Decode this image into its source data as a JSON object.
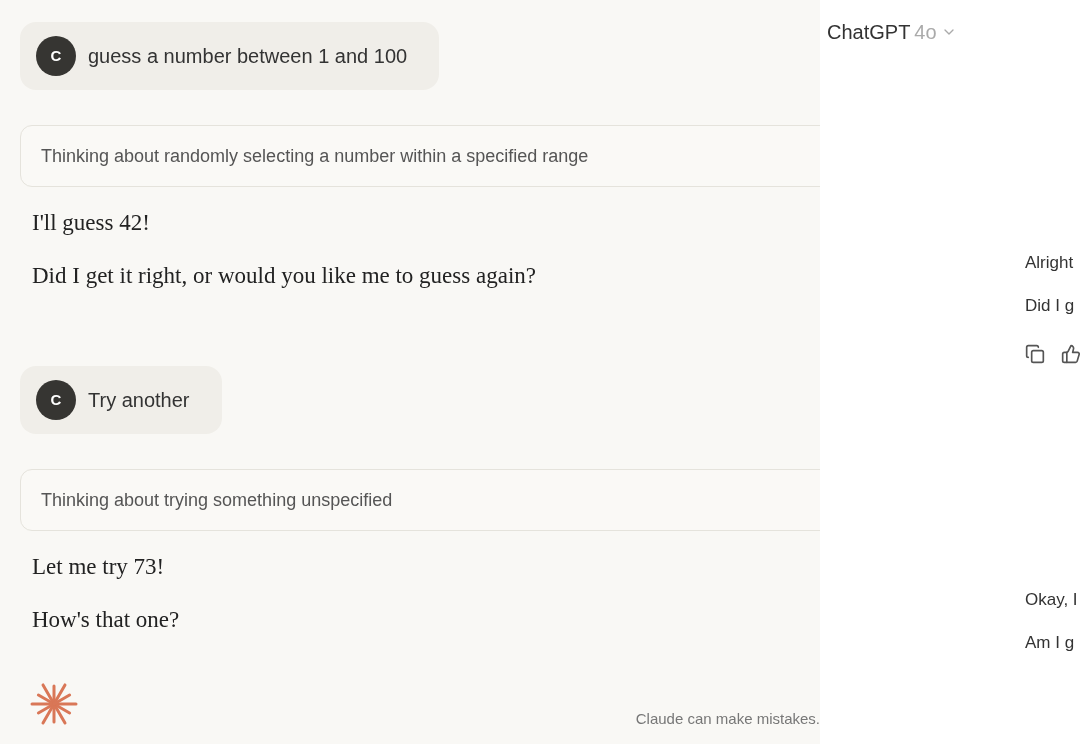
{
  "claude_chat": {
    "messages": [
      {
        "kind": "user",
        "avatar": "C",
        "text": "guess a number between 1 and 100"
      },
      {
        "kind": "thinking",
        "text": "Thinking about randomly selecting a number within a specified range"
      },
      {
        "kind": "reply",
        "paragraphs": [
          "I'll guess 42!",
          "Did I get it right, or would you like me to guess again?"
        ]
      },
      {
        "kind": "user",
        "avatar": "C",
        "text": "Try another"
      },
      {
        "kind": "thinking",
        "text": "Thinking about trying something unspecified"
      },
      {
        "kind": "reply",
        "paragraphs": [
          "Let me try 73!",
          "How's that one?"
        ]
      }
    ],
    "disclaimer": "Claude can make mistakes."
  },
  "chatgpt_chat": {
    "title": "ChatGPT",
    "model": "4o",
    "messages": [
      {
        "paragraphs": [
          "Alright",
          "Did I g"
        ],
        "actions": true
      },
      {
        "paragraphs": [
          "Okay, I",
          "Am I g"
        ],
        "actions": false
      }
    ]
  }
}
